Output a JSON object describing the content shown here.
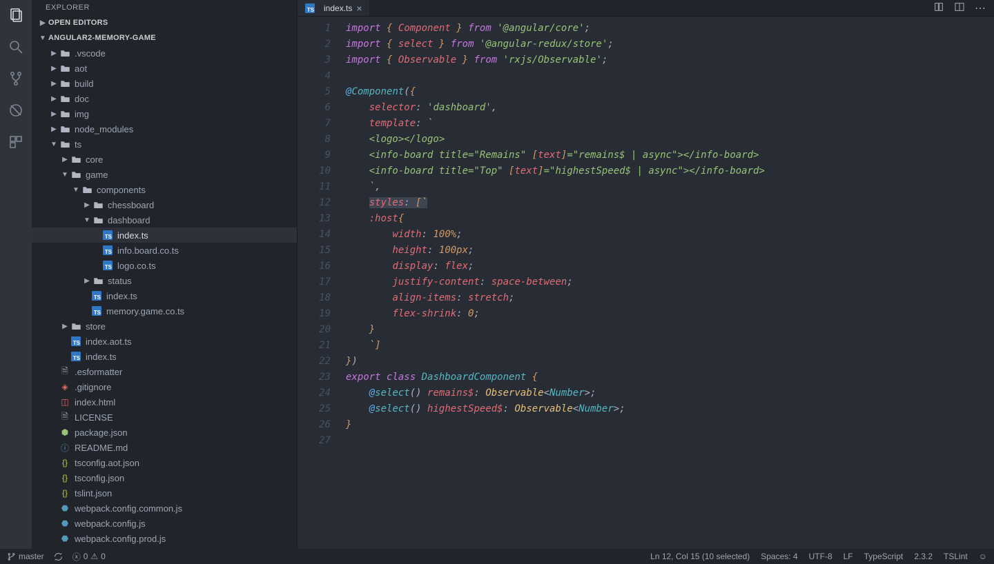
{
  "sidebar": {
    "title": "EXPLORER",
    "openEditors": "OPEN EDITORS",
    "project": "ANGULAR2-MEMORY-GAME",
    "tree": {
      "vscode": ".vscode",
      "aot": "aot",
      "build": "build",
      "doc": "doc",
      "img": "img",
      "node_modules": "node_modules",
      "ts": "ts",
      "core": "core",
      "game": "game",
      "components": "components",
      "chessboard": "chessboard",
      "dashboard": "dashboard",
      "dash_index": "index.ts",
      "infoboard": "info.board.co.ts",
      "logo": "logo.co.ts",
      "status": "status",
      "game_index": "index.ts",
      "memory": "memory.game.co.ts",
      "store": "store",
      "index_aot": "index.aot.ts",
      "ts_index": "index.ts",
      "esformatter": ".esformatter",
      "gitignore": ".gitignore",
      "indexhtml": "index.html",
      "license": "LICENSE",
      "packagejson": "package.json",
      "readme": "README.md",
      "tsconfig_aot": "tsconfig.aot.json",
      "tsconfig": "tsconfig.json",
      "tslint": "tslint.json",
      "wp_common": "webpack.config.common.js",
      "wp_config": "webpack.config.js",
      "wp_prod": "webpack.config.prod.js"
    }
  },
  "tab": {
    "label": "index.ts"
  },
  "code": {
    "lines": [
      "1",
      "2",
      "3",
      "4",
      "5",
      "6",
      "7",
      "8",
      "9",
      "10",
      "11",
      "12",
      "13",
      "14",
      "15",
      "16",
      "17",
      "18",
      "19",
      "20",
      "21",
      "22",
      "23",
      "24",
      "25",
      "26",
      "27"
    ]
  },
  "status": {
    "branch": "master",
    "errors": "0",
    "warnings": "0",
    "cursor": "Ln 12, Col 15 (10 selected)",
    "spaces": "Spaces: 4",
    "encoding": "UTF-8",
    "eol": "LF",
    "lang": "TypeScript",
    "version": "2.3.2",
    "lint": "TSLint"
  }
}
